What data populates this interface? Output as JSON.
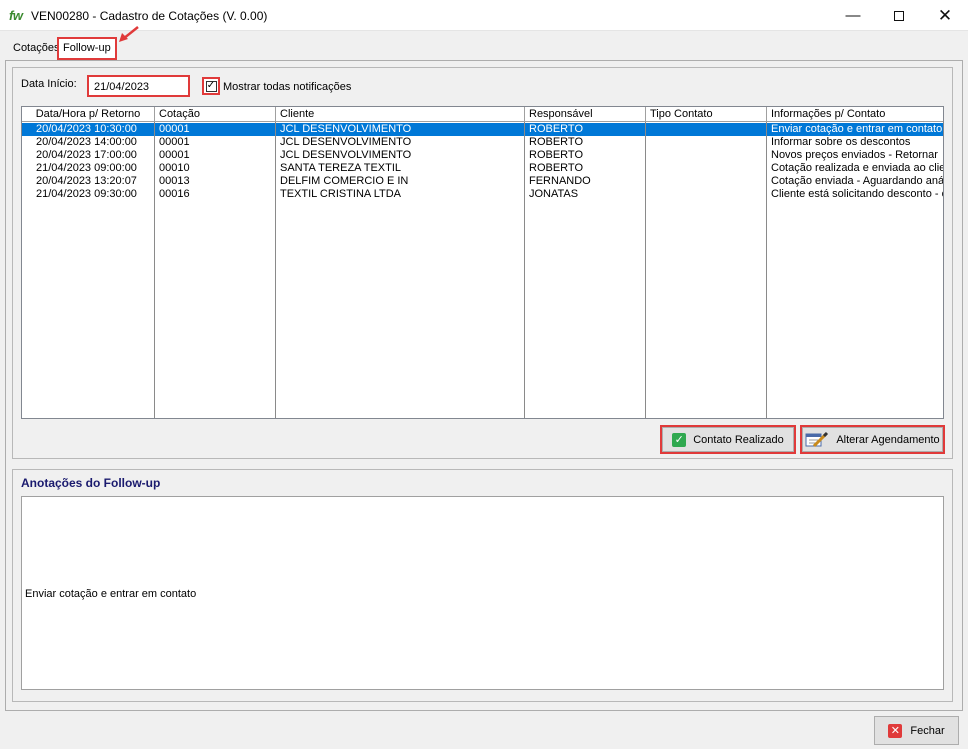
{
  "window": {
    "logo": "fw",
    "title": "VEN00280  -  Cadastro de Cotações  (V. 0.00)",
    "minimize_glyph": "—",
    "close_glyph": "✕"
  },
  "tabs": [
    {
      "label": "Cotações",
      "active": false
    },
    {
      "label": "Follow-up",
      "active": true
    }
  ],
  "filter": {
    "data_inicio_label": "Data Início:",
    "data_inicio_value": "21/04/2023",
    "mostrar_todas_label": "Mostrar todas notificações",
    "mostrar_todas_checked": true
  },
  "grid": {
    "columns": [
      "Data/Hora p/ Retorno",
      "Cotação",
      "Cliente",
      "Responsável",
      "Tipo Contato",
      "Informações p/ Contato"
    ],
    "rows": [
      [
        "20/04/2023 10:30:00",
        "00001",
        "JCL DESENVOLVIMENTO",
        "ROBERTO",
        "",
        "Enviar cotação e entrar em contato"
      ],
      [
        "20/04/2023 14:00:00",
        "00001",
        "JCL DESENVOLVIMENTO",
        "ROBERTO",
        "",
        "Informar sobre os descontos"
      ],
      [
        "20/04/2023 17:00:00",
        "00001",
        "JCL DESENVOLVIMENTO",
        "ROBERTO",
        "",
        "Novos preços enviados - Retornar"
      ],
      [
        "21/04/2023 09:00:00",
        "00010",
        "SANTA TEREZA TEXTIL",
        "ROBERTO",
        "",
        "Cotação realizada e enviada ao clier"
      ],
      [
        "20/04/2023 13:20:07",
        "00013",
        "DELFIM COMERCIO E IN",
        "FERNANDO",
        "",
        "Cotação enviada - Aguardando análi"
      ],
      [
        "21/04/2023 09:30:00",
        "00016",
        "TEXTIL CRISTINA LTDA",
        "JONATAS",
        "",
        "Cliente está solicitando desconto - er"
      ]
    ],
    "selected_row": 0
  },
  "actions": {
    "contato_realizado": "Contato Realizado",
    "alterar_agendamento": "Alterar Agendamento"
  },
  "annotations": {
    "title": "Anotações do Follow-up",
    "text": "Enviar cotação e entrar em contato"
  },
  "footer": {
    "fechar": "Fechar"
  },
  "colors": {
    "selection": "#0078d7",
    "highlight_border": "#e03a3a",
    "success_icon": "#2fa84f",
    "section_title": "#1a1a6e"
  }
}
